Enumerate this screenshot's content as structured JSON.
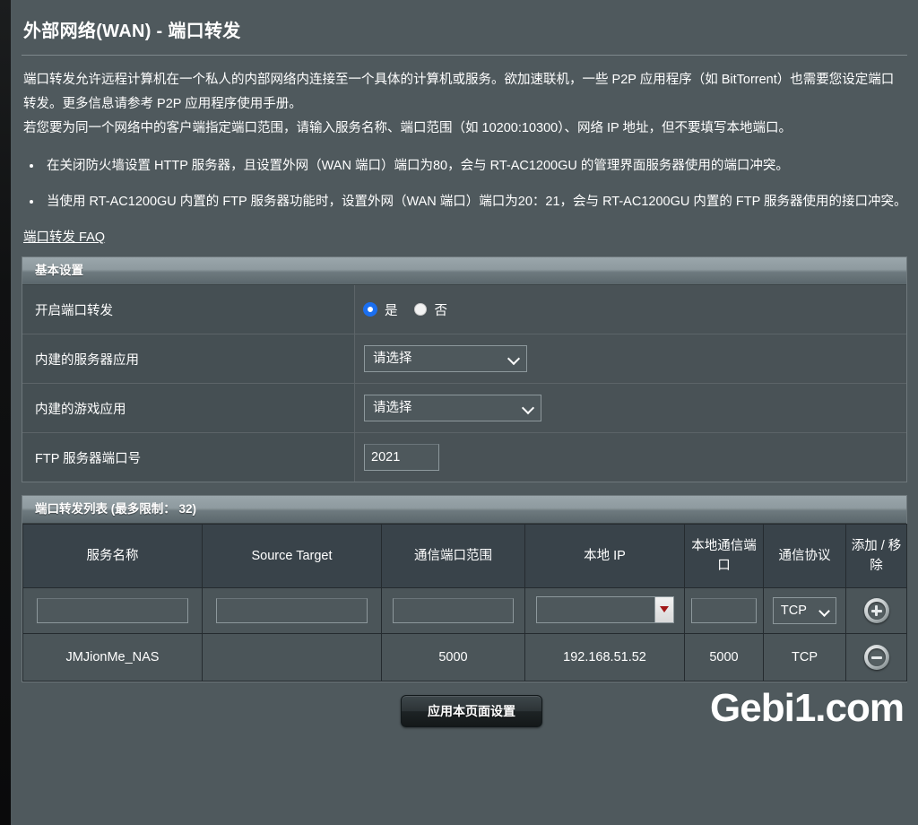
{
  "page": {
    "title": "外部网络(WAN) - 端口转发",
    "description": [
      "端口转发允许远程计算机在一个私人的内部网络内连接至一个具体的计算机或服务。欲加速联机，一些 P2P 应用程序（如 BitTorrent）也需要您设定端口转发。更多信息请参考 P2P 应用程序使用手册。",
      "若您要为同一个网络中的客户端指定端口范围，请输入服务名称、端口范围（如 10200:10300）、网络 IP 地址，但不要填写本地端口。"
    ],
    "notes": [
      "在关闭防火墙设置 HTTP 服务器，且设置外网（WAN 端口）端口为80，会与 RT-AC1200GU 的管理界面服务器使用的端口冲突。",
      "当使用 RT-AC1200GU 内置的 FTP 服务器功能时，设置外网（WAN 端口）端口为20：21，会与 RT-AC1200GU 内置的 FTP 服务器使用的接口冲突。"
    ],
    "faq_link": "端口转发 FAQ",
    "watermark": "Gebi1.com"
  },
  "basic_settings": {
    "header": "基本设置",
    "rows": {
      "enable": {
        "label": "开启端口转发",
        "option_yes": "是",
        "option_no": "否",
        "selected": "是"
      },
      "server_app": {
        "label": "内建的服务器应用",
        "value": "请选择"
      },
      "game_app": {
        "label": "内建的游戏应用",
        "value": "请选择"
      },
      "ftp_port": {
        "label": "FTP 服务器端口号",
        "value": "2021"
      }
    }
  },
  "list_panel": {
    "header": "端口转发列表 (最多限制：  32)",
    "columns": [
      "服务名称",
      "Source Target",
      "通信端口范围",
      "本地 IP",
      "本地通信端口",
      "通信协议",
      "添加 / 移除"
    ],
    "new_row": {
      "service_name": "",
      "source_target": "",
      "port_range": "",
      "local_ip": "",
      "local_port": "",
      "protocol": "TCP",
      "action_icon": "plus-circle-icon"
    },
    "rows": [
      {
        "service_name": "JMJionMe_NAS",
        "source_target": "",
        "port_range": "5000",
        "local_ip": "192.168.51.52",
        "local_port": "5000",
        "protocol": "TCP",
        "action_icon": "minus-circle-icon"
      }
    ]
  },
  "footer": {
    "apply_label": "应用本页面设置"
  },
  "colors": {
    "page_bg": "#4f595d",
    "panel_header_light": "#9aa6ab",
    "table_header_bg": "#39434a",
    "row_bg": "#4b5559",
    "accent_radio": "#1b6ff0",
    "combo_arrow": "#a11717"
  }
}
